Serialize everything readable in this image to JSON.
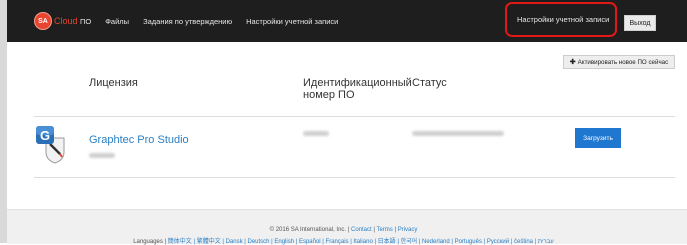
{
  "header": {
    "logo_badge": "SA",
    "logo_text": "Cloud",
    "nav": [
      "ПО",
      "Файлы",
      "Задания по утверждению",
      "Настройки учетной записи"
    ],
    "account_settings": "Настройки учетной записи",
    "logout": "Выход"
  },
  "main": {
    "activate_button": "Активировать новое ПО сейчас",
    "columns": {
      "license": "Лицензия",
      "id_line1": "Идентификационный",
      "id_line2": "номер ПО",
      "status": "Статус"
    },
    "row": {
      "product": "Graphtec Pro Studio",
      "download": "Загрузить"
    }
  },
  "footer": {
    "copyright": "© 2016 SA International, Inc. |",
    "contact": "Contact",
    "sep1": "|",
    "terms": "Terms",
    "sep2": "|",
    "privacy": "Privacy",
    "languages_label": "Languages |",
    "languages": "簡体中文 | 繁體中文 | Dansk | Deutsch | English | Español | Français | Italiano | 日本語 | 한국어 | Nederland | Português | Русский | čeština | עברית"
  },
  "colors": {
    "topbar": "#1e1e1e",
    "accent": "#e8442e",
    "link": "#2a7fc4",
    "download_bg": "#1f77d0",
    "highlight": "#e01818"
  }
}
